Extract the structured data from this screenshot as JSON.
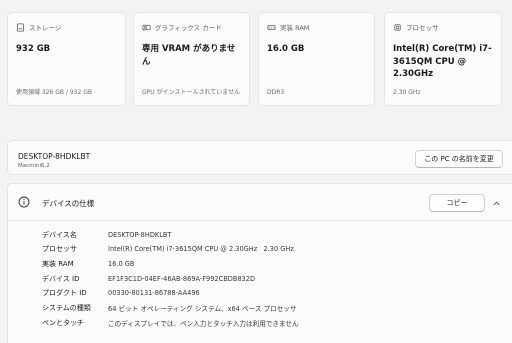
{
  "cards": [
    {
      "icon": "storage-icon",
      "title": "ストレージ",
      "value": "932 GB",
      "sub": "使用領域 326 GB / 932 GB"
    },
    {
      "icon": "graphics-card-icon",
      "title": "グラフィックス カード",
      "value": "専用 VRAM がありません",
      "sub": "GPU がインストールされていません"
    },
    {
      "icon": "ram-icon",
      "title": "実装 RAM",
      "value": "16.0 GB",
      "sub": "DDR3"
    },
    {
      "icon": "processor-icon",
      "title": "プロセッサ",
      "value": "Intel(R) Core(TM) i7-3615QM CPU @ 2.30GHz",
      "sub": "2.30 GHz"
    }
  ],
  "pc": {
    "name": "DESKTOP-8HDKLBT",
    "model": "Macmini6,2",
    "rename_label": "この PC の名前を変更"
  },
  "specs": {
    "title": "デバイスの仕様",
    "copy_label": "コピー",
    "rows": [
      {
        "label": "デバイス名",
        "value": "DESKTOP-8HDKLBT"
      },
      {
        "label": "プロセッサ",
        "value": "Intel(R) Core(TM) i7-3615QM CPU @ 2.30GHz   2.30 GHz"
      },
      {
        "label": "実装 RAM",
        "value": "16.0 GB"
      },
      {
        "label": "デバイス ID",
        "value": "EF1F3C1D-04EF-46AB-869A-F992CBDB832D"
      },
      {
        "label": "プロダクト ID",
        "value": "00330-80131-86788-AA496"
      },
      {
        "label": "システムの種類",
        "value": "64 ビット オペレーティング システム、x64 ベース プロセッサ"
      },
      {
        "label": "ペンとタッチ",
        "value": "このディスプレイでは、ペン入力とタッチ入力は利用できません"
      }
    ]
  }
}
